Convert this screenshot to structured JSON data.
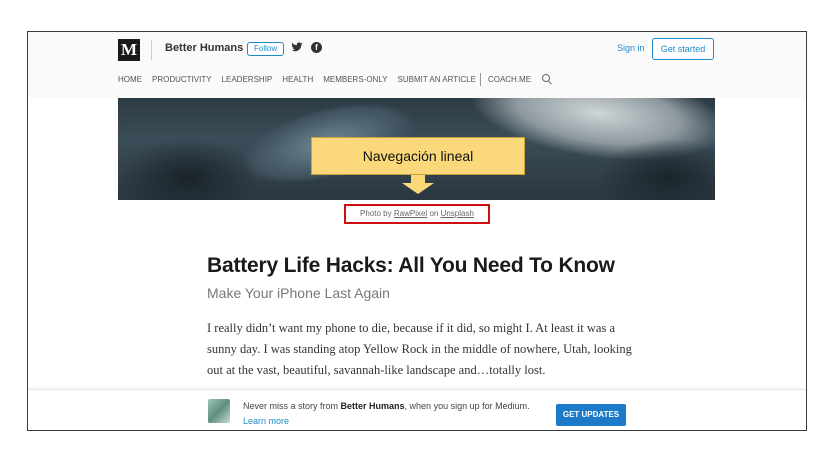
{
  "header": {
    "logo_letter": "M",
    "publication": "Better Humans",
    "follow_label": "Follow",
    "signin_label": "Sign in",
    "getstarted_label": "Get started",
    "social_icons": [
      "twitter-icon",
      "facebook-icon"
    ]
  },
  "nav": {
    "items_left": [
      "HOME",
      "PRODUCTIVITY",
      "LEADERSHIP",
      "HEALTH",
      "MEMBERS-ONLY",
      "SUBMIT AN ARTICLE"
    ],
    "items_right": [
      "COACH.ME"
    ],
    "search_icon": "search-icon"
  },
  "annotation": {
    "label": "Navegación lineal",
    "color": "#fbd87a",
    "highlight_color": "#d01010"
  },
  "credit": {
    "prefix": "Photo by",
    "author": "RawPixel",
    "on": "on",
    "source": "Unsplash"
  },
  "article": {
    "title": "Battery Life Hacks: All You Need To Know",
    "subtitle": "Make Your iPhone Last Again",
    "paragraph": "I really didn’t want my phone to die, because if it did, so might I. At least it was a sunny day. I was standing atop Yellow Rock in the middle of nowhere, Utah, looking out at the vast, beautiful, savannah-like landscape and…totally lost."
  },
  "banner": {
    "text_before": "Never miss a story from",
    "publication": "Better Humans",
    "text_after": ", when you sign up for Medium.",
    "learn_more": "Learn more",
    "button_label": "GET UPDATES",
    "accent": "#1c7ac9"
  }
}
